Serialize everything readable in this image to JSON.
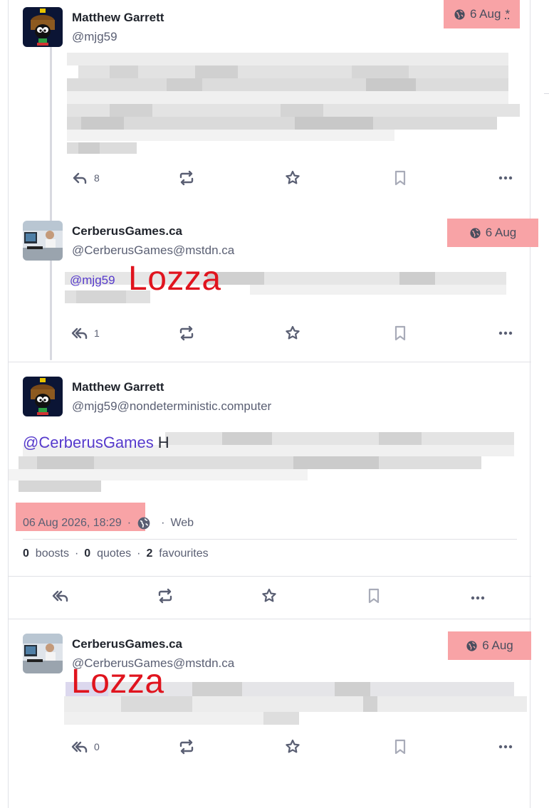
{
  "thread": [
    {
      "author": {
        "name": "Matthew Garrett",
        "handle": "@mjg59"
      },
      "time": {
        "label": "6 Aug",
        "edited_mark": "*",
        "visibility_icon": "globe-icon"
      },
      "actions": {
        "reply_count": "8"
      }
    },
    {
      "author": {
        "name": "CerberusGames.ca",
        "handle": "@CerberusGames@mstdn.ca"
      },
      "time": {
        "label": "6 Aug",
        "visibility_icon": "globe-icon"
      },
      "mention": "@mjg59",
      "overlay": "Lozza",
      "actions": {
        "reply_count": "1"
      }
    }
  ],
  "focused": {
    "author": {
      "name": "Matthew Garrett",
      "handle": "@mjg59@nondeterministic.computer"
    },
    "mention": "@CerberusGames",
    "mention_tail": "H",
    "meta": {
      "datetime": "06 Aug 2026, 18:29",
      "separator": "·",
      "client": "Web",
      "visibility_icon": "globe-icon"
    },
    "stats": {
      "boosts_count": "0",
      "boosts_label": "boosts",
      "quotes_count": "0",
      "quotes_label": "quotes",
      "favourites_count": "2",
      "favourites_label": "favourites",
      "separator": "·"
    }
  },
  "reply": {
    "author": {
      "name": "CerberusGames.ca",
      "handle": "@CerberusGames@mstdn.ca"
    },
    "time": {
      "label": "6 Aug",
      "visibility_icon": "globe-icon"
    },
    "overlay": "Lozza",
    "actions": {
      "reply_count": "0"
    }
  },
  "colors": {
    "accent": "#563acc",
    "highlight": "#f8a3a6",
    "overlay_text": "#e0141e",
    "icon": "#5a5f73"
  }
}
